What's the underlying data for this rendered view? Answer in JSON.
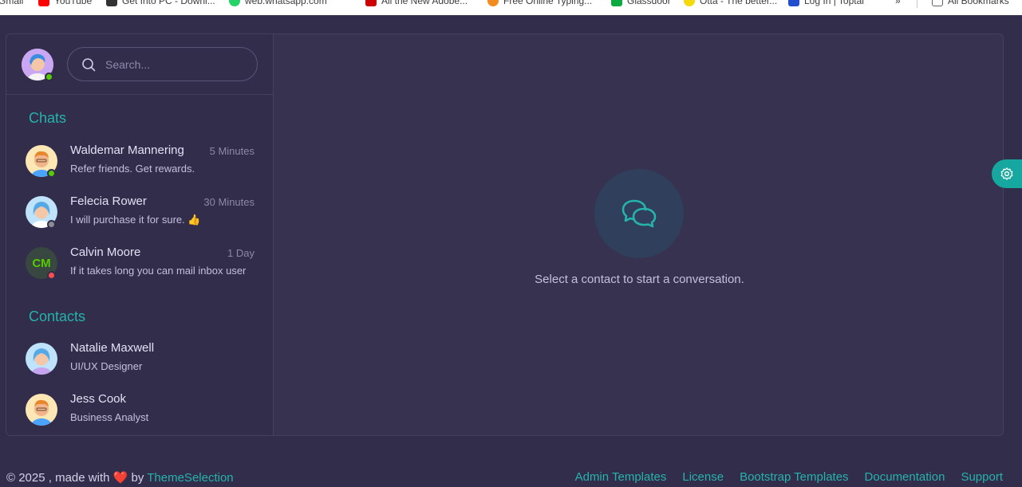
{
  "bookmarks": [
    {
      "label": "Gmail",
      "icon": "gmail-icon",
      "color": "#ea4335"
    },
    {
      "label": "YouTube",
      "icon": "youtube-icon",
      "color": "#ff0000"
    },
    {
      "label": "Get Into PC - Downl...",
      "icon": "getintopc-icon",
      "color": "#333333"
    },
    {
      "label": "web.whatsapp.com",
      "icon": "whatsapp-icon",
      "color": "#25d366"
    },
    {
      "label": "All the New Adobe...",
      "icon": "adobe-icon",
      "color": "#cc0000"
    },
    {
      "label": "Free Online Typing...",
      "icon": "typing-icon",
      "color": "#f28b20"
    },
    {
      "label": "Glassdoor",
      "icon": "glassdoor-icon",
      "color": "#0caa41"
    },
    {
      "label": "Otta - The better...",
      "icon": "otta-icon",
      "color": "#f5d90a"
    },
    {
      "label": "Log In | Toptal",
      "icon": "toptal-icon",
      "color": "#204ecf"
    },
    {
      "label": "All Bookmarks",
      "icon": "folder-icon",
      "color": "#5f6368"
    }
  ],
  "search": {
    "placeholder": "Search..."
  },
  "chats_title": "Chats",
  "contacts_title": "Contacts",
  "chats": [
    {
      "name": "Waldemar Mannering",
      "time": "5 Minutes",
      "message": "Refer friends. Get rewards.",
      "status": "online",
      "status_color": "#56ca00"
    },
    {
      "name": "Felecia Rower",
      "time": "30 Minutes",
      "message": "I will purchase it for sure. 👍",
      "status": "offline",
      "status_color": "#8a8d93"
    },
    {
      "name": "Calvin Moore",
      "time": "1 Day",
      "message": "If it takes long you can mail inbox user",
      "initials": "CM",
      "status": "busy",
      "status_color": "#ff4c51"
    }
  ],
  "contacts": [
    {
      "name": "Natalie Maxwell",
      "role": "UI/UX Designer"
    },
    {
      "name": "Jess Cook",
      "role": "Business Analyst"
    }
  ],
  "welcome": {
    "text": "Select a contact to start a conversation."
  },
  "footer": {
    "copyright": "© 2025 , made with",
    "by": "by",
    "brand": "ThemeSelection",
    "links": [
      "Admin Templates",
      "License",
      "Bootstrap Templates",
      "Documentation",
      "Support"
    ]
  },
  "colors": {
    "accent": "#26b3ab",
    "bg": "#312d4b",
    "card": "#36324f"
  }
}
